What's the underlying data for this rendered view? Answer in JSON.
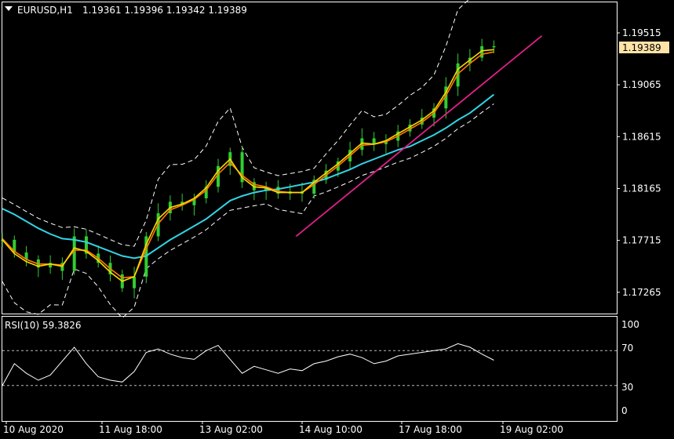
{
  "header": {
    "symbol": "EURUSD,H1",
    "ohlc": "1.19361 1.19396 1.19342 1.19389"
  },
  "current_price": "1.19389",
  "rsi": {
    "label": "RSI(10) 59.3826",
    "levels": [
      "100",
      "70",
      "30",
      "0"
    ]
  },
  "colors": {
    "background": "#000000",
    "candles": "#32cd32",
    "ma_fast": "#ffd700",
    "ma_mid": "#ff7f00",
    "ma_slow": "#33d4e4",
    "trendline": "#e0218a",
    "bands": "#ffffff",
    "rsi_line": "#ffffff",
    "price_box": "#ffe3a8"
  },
  "chart_data": [
    {
      "type": "candlestick",
      "title": "EURUSD,H1",
      "y_ticks": [
        "1.19515",
        "1.19065",
        "1.18615",
        "1.18165",
        "1.17715",
        "1.17265"
      ],
      "x_ticks": [
        "10 Aug 2020",
        "11 Aug 18:00",
        "13 Aug 02:00",
        "14 Aug 10:00",
        "17 Aug 18:00",
        "19 Aug 02:00"
      ],
      "ylim": [
        1.1708,
        1.1978
      ],
      "x": [
        0,
        4,
        8,
        12,
        16,
        20,
        24,
        28,
        32,
        36,
        40,
        44,
        48,
        52,
        56,
        60,
        64,
        68,
        72,
        76,
        80,
        84,
        88,
        92,
        96,
        100,
        104,
        108,
        112,
        116,
        120,
        124,
        128,
        132,
        136,
        140,
        144,
        148,
        152,
        156,
        160,
        164
      ],
      "close": [
        1.1772,
        1.1761,
        1.1755,
        1.1748,
        1.1752,
        1.1745,
        1.1775,
        1.176,
        1.1752,
        1.1742,
        1.173,
        1.174,
        1.1775,
        1.1795,
        1.1805,
        1.1802,
        1.1808,
        1.1818,
        1.1836,
        1.1848,
        1.1822,
        1.1815,
        1.1818,
        1.1812,
        1.1814,
        1.1812,
        1.1824,
        1.1832,
        1.184,
        1.185,
        1.186,
        1.1855,
        1.1858,
        1.1866,
        1.1872,
        1.1878,
        1.1886,
        1.1905,
        1.1925,
        1.193,
        1.194,
        1.1939
      ],
      "series": [
        {
          "name": "",
          "kind": "ma_fast",
          "values": [
            1.1772,
            1.176,
            1.1753,
            1.1749,
            1.1751,
            1.1749,
            1.1765,
            1.1762,
            1.1754,
            1.1744,
            1.1736,
            1.174,
            1.1768,
            1.179,
            1.18,
            1.1803,
            1.1808,
            1.1817,
            1.1832,
            1.1842,
            1.1826,
            1.1818,
            1.1817,
            1.1813,
            1.1813,
            1.1813,
            1.1822,
            1.183,
            1.1838,
            1.1847,
            1.1856,
            1.1855,
            1.1858,
            1.1864,
            1.187,
            1.1876,
            1.1884,
            1.19,
            1.192,
            1.1928,
            1.1936,
            1.1937
          ]
        },
        {
          "name": "",
          "kind": "ma_mid",
          "values": [
            1.1773,
            1.1762,
            1.1755,
            1.1751,
            1.1751,
            1.175,
            1.1763,
            1.1763,
            1.1756,
            1.1747,
            1.1739,
            1.174,
            1.1764,
            1.1786,
            1.1798,
            1.1802,
            1.1807,
            1.1815,
            1.1829,
            1.1839,
            1.1828,
            1.182,
            1.1818,
            1.1814,
            1.1813,
            1.1813,
            1.182,
            1.1828,
            1.1836,
            1.1845,
            1.1854,
            1.1855,
            1.1857,
            1.1862,
            1.1868,
            1.1874,
            1.1882,
            1.1897,
            1.1916,
            1.1925,
            1.1933,
            1.1935
          ]
        },
        {
          "name": "",
          "kind": "ma_slow",
          "values": [
            1.1799,
            1.1794,
            1.1788,
            1.1782,
            1.1777,
            1.1773,
            1.1772,
            1.177,
            1.1766,
            1.1762,
            1.1758,
            1.1756,
            1.1758,
            1.1765,
            1.1772,
            1.1778,
            1.1784,
            1.179,
            1.1798,
            1.1806,
            1.181,
            1.1813,
            1.1815,
            1.1816,
            1.1818,
            1.182,
            1.1822,
            1.1825,
            1.1829,
            1.1833,
            1.1838,
            1.1842,
            1.1846,
            1.185,
            1.1853,
            1.1858,
            1.1863,
            1.1869,
            1.1876,
            1.1882,
            1.189,
            1.1898
          ]
        }
      ],
      "trendline": [
        {
          "x": 98,
          "y": 1.1775
        },
        {
          "x": 180,
          "y": 1.1949
        }
      ],
      "grid": false
    },
    {
      "type": "line",
      "title": "RSI(10) 59.3826",
      "ylim": [
        0,
        100
      ],
      "levels": [
        30,
        70
      ],
      "x": [
        0,
        4,
        8,
        12,
        16,
        20,
        24,
        28,
        32,
        36,
        40,
        44,
        48,
        52,
        56,
        60,
        64,
        68,
        72,
        76,
        80,
        84,
        88,
        92,
        96,
        100,
        104,
        108,
        112,
        116,
        120,
        124,
        128,
        132,
        136,
        140,
        144,
        148,
        152,
        156,
        160,
        164
      ],
      "values": [
        30,
        55,
        44,
        36,
        42,
        58,
        74,
        55,
        40,
        36,
        34,
        46,
        68,
        72,
        66,
        62,
        60,
        70,
        76,
        60,
        44,
        52,
        48,
        44,
        49,
        47,
        55,
        58,
        63,
        66,
        62,
        55,
        58,
        64,
        66,
        68,
        70,
        72,
        78,
        74,
        66,
        59
      ],
      "grid": false
    }
  ]
}
